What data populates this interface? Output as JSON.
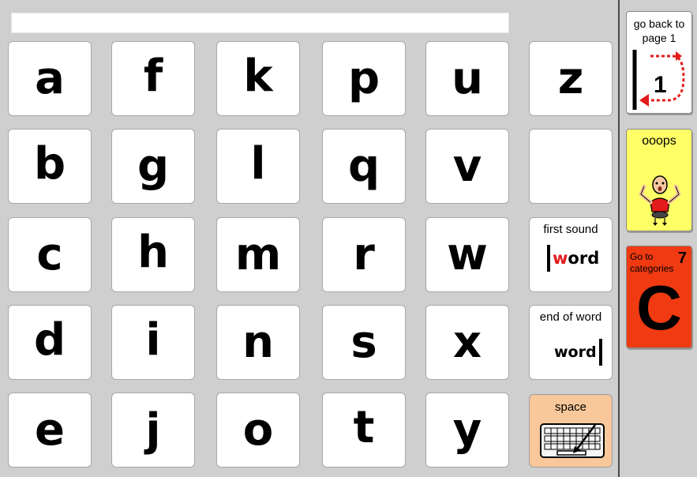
{
  "message_bar": {
    "text": ""
  },
  "letters": {
    "a": "a",
    "b": "b",
    "c": "c",
    "d": "d",
    "e": "e",
    "f": "f",
    "g": "g",
    "h": "h",
    "i": "i",
    "j": "j",
    "k": "k",
    "l": "l",
    "m": "m",
    "n": "n",
    "o": "o",
    "p": "p",
    "q": "q",
    "r": "r",
    "s": "s",
    "t": "t",
    "u": "u",
    "v": "v",
    "w": "w",
    "x": "x",
    "y": "y",
    "z": "z"
  },
  "first_sound": {
    "label": "first sound",
    "word_first": "w",
    "word_rest": "ord",
    "accent": "#e31b1b"
  },
  "end_of_word": {
    "label": "end of word",
    "word": "word"
  },
  "space": {
    "label": "space",
    "color": "#f8c89a"
  },
  "sidebar": {
    "back": {
      "label": "go back to page 1",
      "page_number": "1",
      "arrow_color": "#e31b1b"
    },
    "oops": {
      "label": "ooops",
      "color": "#ffff66"
    },
    "categories": {
      "label": "Go to categories",
      "number": "7",
      "letter": "C",
      "color": "#f03a12"
    }
  }
}
